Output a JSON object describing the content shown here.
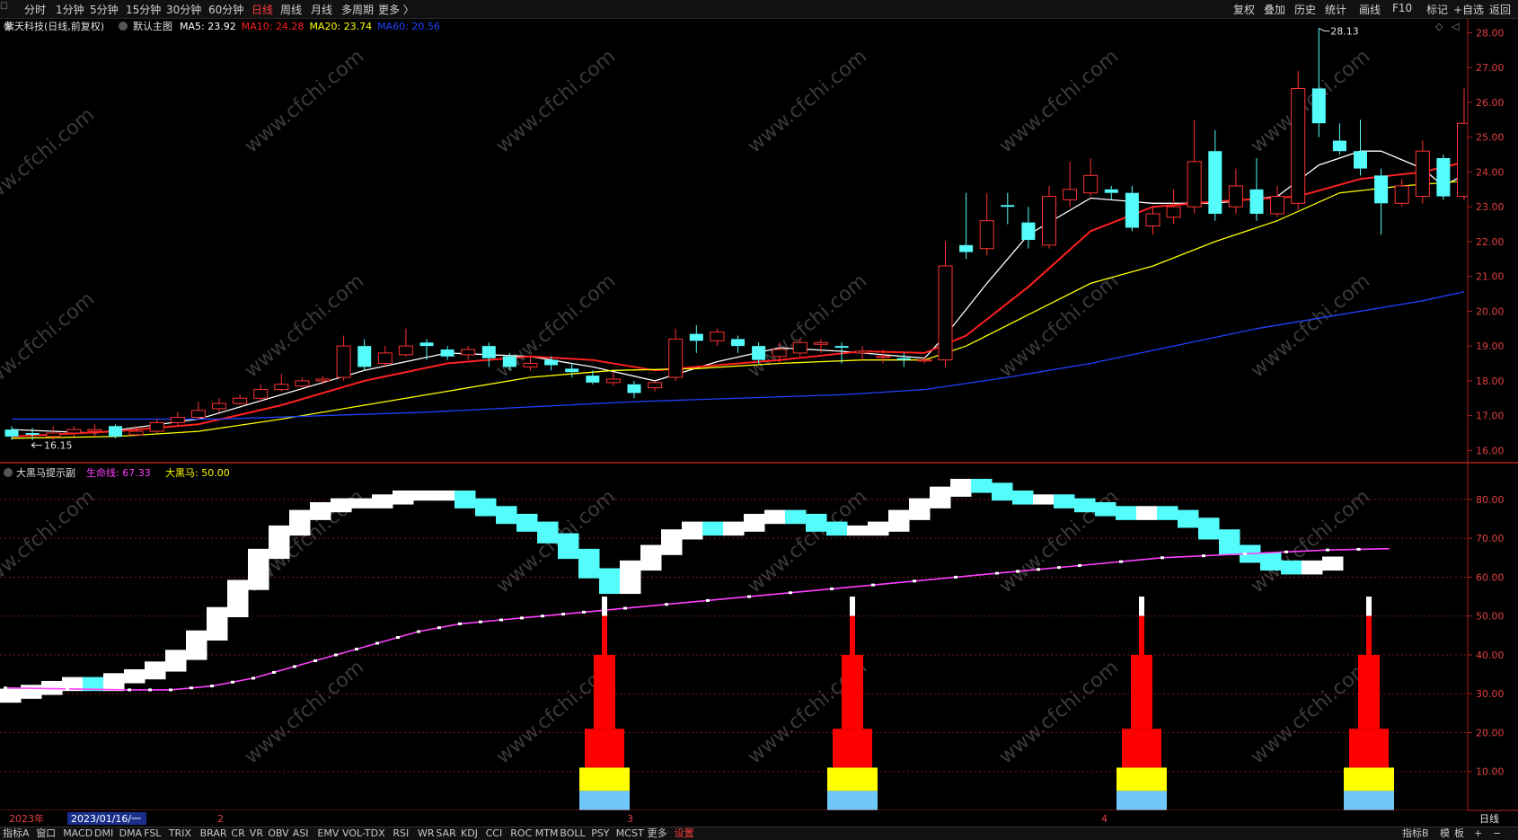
{
  "toolbar": {
    "timeframes": [
      "分时",
      "1分钟",
      "5分钟",
      "15分钟",
      "30分钟",
      "60分钟",
      "日线",
      "周线",
      "月线",
      "多周期",
      "更多 〉"
    ],
    "active_timeframe": "日线",
    "right_buttons": [
      "复权",
      "叠加",
      "历史",
      "统计",
      "画线",
      "F10",
      "标记",
      "+自选",
      "返回"
    ]
  },
  "main_panel": {
    "stock_name": "紫天科技(日线,前复权)",
    "chart_name": "默认主图",
    "ma_labels": [
      {
        "label": "MA5: 23.92",
        "color": "#ffffff"
      },
      {
        "label": "MA10: 24.28",
        "color": "#ff2020"
      },
      {
        "label": "MA20: 23.74",
        "color": "#ffff00"
      },
      {
        "label": "MA60: 20.56",
        "color": "#2040ff"
      }
    ],
    "high_label": "28.13",
    "low_label": "16.15"
  },
  "sub_panel": {
    "indicator_name": "大黑马提示副",
    "line1_label": "生命线: 67.33",
    "line1_color": "#ff40ff",
    "line2_label": "大黑马: 50.00",
    "line2_color": "#ffff00"
  },
  "x_axis": {
    "labels": [
      "2023年",
      "2023/01/16/一",
      "2",
      "3",
      "4"
    ],
    "right_label": "日线"
  },
  "bottom_tabs": [
    "指标A",
    "窗口",
    "MACD",
    "DMI",
    "DMA",
    "FSL",
    "TRIX",
    "BRAR",
    "CR",
    "VR",
    "OBV",
    "ASI",
    "EMV",
    "VOL-TDX",
    "RSI",
    "WR",
    "SAR",
    "KDJ",
    "CCI",
    "ROC",
    "MTM",
    "BOLL",
    "PSY",
    "MCST",
    "更多",
    "设置"
  ],
  "bottom_right": [
    "指标B",
    "模",
    "板",
    "+",
    "−"
  ],
  "watermark": "www.cfchi.com",
  "chart_data": [
    {
      "type": "candlestick",
      "title": "紫天科技(日线,前复权)",
      "ylim": [
        15.7,
        28.4
      ],
      "yticks": [
        16,
        17,
        18,
        19,
        20,
        21,
        22,
        23,
        24,
        25,
        26,
        27,
        28
      ],
      "colors": {
        "up": "#ff3232",
        "down": "#54fcfc"
      },
      "candles": [
        [
          16.6,
          16.4,
          16.7,
          16.3
        ],
        [
          16.5,
          16.45,
          16.65,
          16.3
        ],
        [
          16.4,
          16.5,
          16.7,
          16.3
        ],
        [
          16.5,
          16.6,
          16.7,
          16.4
        ],
        [
          16.55,
          16.6,
          16.75,
          16.4
        ],
        [
          16.7,
          16.4,
          16.75,
          16.35
        ],
        [
          16.45,
          16.55,
          16.7,
          16.4
        ],
        [
          16.55,
          16.8,
          16.9,
          16.5
        ],
        [
          16.8,
          16.95,
          17.1,
          16.7
        ],
        [
          16.95,
          17.15,
          17.4,
          16.9
        ],
        [
          17.2,
          17.35,
          17.5,
          17.1
        ],
        [
          17.35,
          17.5,
          17.6,
          17.3
        ],
        [
          17.5,
          17.75,
          17.9,
          17.4
        ],
        [
          17.75,
          17.9,
          18.2,
          17.7
        ],
        [
          17.85,
          18.0,
          18.1,
          17.8
        ],
        [
          18.0,
          18.05,
          18.15,
          17.9
        ],
        [
          18.1,
          19.0,
          19.3,
          18.0
        ],
        [
          19.0,
          18.4,
          19.2,
          18.3
        ],
        [
          18.5,
          18.8,
          19.0,
          18.4
        ],
        [
          18.75,
          19.0,
          19.5,
          18.7
        ],
        [
          19.1,
          19.0,
          19.2,
          18.6
        ],
        [
          18.9,
          18.7,
          19.0,
          18.6
        ],
        [
          18.75,
          18.9,
          19.0,
          18.6
        ],
        [
          19.0,
          18.65,
          19.1,
          18.4
        ],
        [
          18.7,
          18.4,
          18.8,
          18.3
        ],
        [
          18.4,
          18.5,
          18.7,
          18.3
        ],
        [
          18.6,
          18.45,
          18.7,
          18.3
        ],
        [
          18.35,
          18.25,
          18.5,
          18.1
        ],
        [
          18.15,
          17.95,
          18.3,
          17.9
        ],
        [
          17.95,
          18.05,
          18.25,
          17.85
        ],
        [
          17.9,
          17.65,
          18.0,
          17.5
        ],
        [
          17.8,
          17.95,
          18.0,
          17.7
        ],
        [
          18.1,
          19.2,
          19.5,
          18.0
        ],
        [
          19.35,
          19.15,
          19.6,
          18.8
        ],
        [
          19.15,
          19.4,
          19.5,
          19.0
        ],
        [
          19.2,
          19.0,
          19.3,
          18.8
        ],
        [
          19.0,
          18.6,
          19.1,
          18.5
        ],
        [
          18.7,
          18.9,
          19.1,
          18.5
        ],
        [
          18.8,
          19.1,
          19.2,
          18.7
        ],
        [
          19.05,
          19.1,
          19.2,
          18.8
        ],
        [
          19.0,
          18.95,
          19.1,
          18.5
        ],
        [
          18.8,
          18.85,
          19.0,
          18.6
        ],
        [
          18.7,
          18.7,
          18.9,
          18.5
        ],
        [
          18.65,
          18.6,
          18.8,
          18.4
        ],
        [
          18.6,
          18.6,
          18.7,
          18.5
        ],
        [
          18.6,
          21.3,
          22.0,
          18.4
        ],
        [
          21.9,
          21.7,
          23.4,
          21.5
        ],
        [
          21.8,
          22.6,
          23.4,
          21.6
        ],
        [
          23.05,
          23.0,
          23.4,
          22.5
        ],
        [
          22.55,
          22.05,
          23.0,
          21.8
        ],
        [
          21.9,
          23.3,
          23.6,
          21.8
        ],
        [
          23.2,
          23.5,
          24.3,
          23.0
        ],
        [
          23.4,
          23.9,
          24.4,
          23.3
        ],
        [
          23.5,
          23.4,
          23.6,
          23.2
        ],
        [
          23.4,
          22.4,
          23.6,
          22.3
        ],
        [
          22.45,
          22.8,
          23.0,
          22.2
        ],
        [
          22.7,
          23.0,
          23.5,
          22.5
        ],
        [
          23.0,
          24.3,
          25.5,
          22.8
        ],
        [
          24.6,
          22.8,
          25.2,
          22.6
        ],
        [
          23.0,
          23.6,
          24.1,
          22.8
        ],
        [
          23.5,
          22.8,
          24.4,
          22.6
        ],
        [
          22.8,
          23.3,
          23.6,
          22.7
        ],
        [
          23.1,
          26.4,
          26.9,
          22.9
        ],
        [
          26.4,
          25.4,
          28.13,
          25.0
        ],
        [
          24.9,
          24.6,
          25.4,
          24.5
        ],
        [
          24.6,
          24.1,
          25.5,
          23.9
        ],
        [
          23.9,
          23.1,
          24.1,
          22.2
        ],
        [
          23.1,
          23.6,
          23.8,
          23.0
        ],
        [
          23.3,
          24.6,
          24.9,
          23.1
        ],
        [
          24.4,
          23.3,
          24.5,
          23.2
        ],
        [
          23.3,
          25.4,
          26.4,
          23.2
        ]
      ],
      "ma_series": [
        {
          "name": "MA5",
          "color": "#ffffff",
          "points": [
            [
              0,
              16.6
            ],
            [
              4,
              16.5
            ],
            [
              9,
              16.9
            ],
            [
              13,
              17.6
            ],
            [
              17,
              18.3
            ],
            [
              21,
              18.8
            ],
            [
              25,
              18.7
            ],
            [
              28,
              18.4
            ],
            [
              31,
              18.0
            ],
            [
              34,
              18.55
            ],
            [
              37,
              18.95
            ],
            [
              40,
              18.85
            ],
            [
              44,
              18.65
            ],
            [
              45,
              19.3
            ],
            [
              47,
              20.8
            ],
            [
              49,
              22.2
            ],
            [
              52,
              23.25
            ],
            [
              55,
              23.1
            ],
            [
              58,
              23.1
            ],
            [
              61,
              23.3
            ],
            [
              63,
              24.2
            ],
            [
              65,
              24.6
            ],
            [
              66,
              24.6
            ],
            [
              68,
              24.1
            ],
            [
              69,
              23.6
            ],
            [
              70,
              23.92
            ]
          ]
        },
        {
          "name": "MA10",
          "color": "#ff2020",
          "points": [
            [
              0,
              16.4
            ],
            [
              5,
              16.55
            ],
            [
              9,
              16.75
            ],
            [
              13,
              17.3
            ],
            [
              17,
              18.0
            ],
            [
              21,
              18.5
            ],
            [
              25,
              18.7
            ],
            [
              28,
              18.6
            ],
            [
              31,
              18.3
            ],
            [
              34,
              18.45
            ],
            [
              37,
              18.6
            ],
            [
              41,
              18.85
            ],
            [
              44,
              18.8
            ],
            [
              46,
              19.3
            ],
            [
              49,
              20.7
            ],
            [
              52,
              22.3
            ],
            [
              55,
              23.0
            ],
            [
              58,
              23.15
            ],
            [
              62,
              23.3
            ],
            [
              65,
              23.8
            ],
            [
              68,
              24.0
            ],
            [
              70,
              24.28
            ]
          ]
        },
        {
          "name": "MA20",
          "color": "#ffff00",
          "points": [
            [
              0,
              16.35
            ],
            [
              5,
              16.4
            ],
            [
              9,
              16.55
            ],
            [
              13,
              16.9
            ],
            [
              17,
              17.3
            ],
            [
              21,
              17.7
            ],
            [
              25,
              18.1
            ],
            [
              29,
              18.3
            ],
            [
              33,
              18.35
            ],
            [
              37,
              18.5
            ],
            [
              41,
              18.6
            ],
            [
              44,
              18.6
            ],
            [
              46,
              19.0
            ],
            [
              49,
              19.9
            ],
            [
              52,
              20.8
            ],
            [
              55,
              21.3
            ],
            [
              58,
              22.0
            ],
            [
              61,
              22.6
            ],
            [
              64,
              23.4
            ],
            [
              67,
              23.6
            ],
            [
              70,
              23.74
            ]
          ]
        },
        {
          "name": "MA60",
          "color": "#2040ff",
          "points": [
            [
              0,
              16.9
            ],
            [
              10,
              16.9
            ],
            [
              20,
              17.1
            ],
            [
              30,
              17.4
            ],
            [
              40,
              17.6
            ],
            [
              44,
              17.75
            ],
            [
              48,
              18.1
            ],
            [
              52,
              18.5
            ],
            [
              56,
              19.0
            ],
            [
              60,
              19.5
            ],
            [
              64,
              19.9
            ],
            [
              68,
              20.3
            ],
            [
              70,
              20.56
            ]
          ]
        }
      ]
    },
    {
      "type": "indicator",
      "title": "大黑马提示副",
      "ylim": [
        0,
        89
      ],
      "yticks": [
        10,
        20,
        30,
        40,
        50,
        60,
        70,
        80
      ],
      "dashed_gridlines": [
        10,
        20,
        30,
        40,
        50,
        60,
        70,
        80
      ],
      "band_values": [
        30,
        31,
        32,
        33,
        32,
        34,
        35,
        37,
        40,
        45,
        51,
        58,
        66,
        72,
        76,
        78,
        79,
        79,
        80,
        81,
        81,
        81,
        79,
        77,
        75,
        73,
        70,
        66,
        61,
        57,
        63,
        67,
        71,
        73,
        72,
        73,
        75,
        76,
        75,
        73,
        72,
        72,
        73,
        76,
        79,
        82,
        84,
        83,
        81,
        80,
        80,
        79,
        78,
        77,
        76,
        77,
        76,
        74,
        71,
        67,
        65,
        63,
        62,
        63,
        64
      ],
      "band_colors": {
        "rising": "#ffffff",
        "falling": "#54fcfc"
      },
      "series": [
        {
          "name": "生命线",
          "color": "#ff40ff",
          "points": [
            [
              0,
              31.5
            ],
            [
              6,
              31
            ],
            [
              8,
              31
            ],
            [
              10,
              32
            ],
            [
              12,
              34
            ],
            [
              14,
              37
            ],
            [
              16,
              40
            ],
            [
              18,
              43
            ],
            [
              20,
              46
            ],
            [
              22,
              48
            ],
            [
              24,
              49
            ],
            [
              26,
              50
            ],
            [
              28,
              51
            ],
            [
              32,
              53
            ],
            [
              36,
              55
            ],
            [
              40,
              57
            ],
            [
              44,
              59
            ],
            [
              48,
              61
            ],
            [
              50,
              62
            ],
            [
              52,
              63
            ],
            [
              56,
              65
            ],
            [
              60,
              66
            ],
            [
              64,
              67
            ],
            [
              67,
              67.33
            ]
          ]
        }
      ],
      "signals": [
        {
          "x": 29,
          "name": "大黑马",
          "value": 50
        },
        {
          "x": 41,
          "name": "大黑马",
          "value": 50
        },
        {
          "x": 55,
          "name": "大黑马",
          "value": 50
        },
        {
          "x": 66,
          "name": "大黑马",
          "value": 50
        }
      ]
    }
  ]
}
